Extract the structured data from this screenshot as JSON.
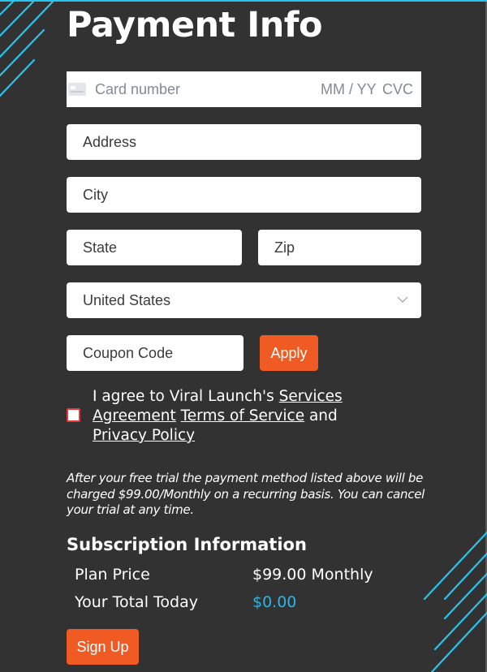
{
  "page": {
    "title": "Payment Info"
  },
  "card": {
    "icon": "credit-card-icon",
    "number_placeholder": "Card number",
    "expiry_placeholder": "MM / YY",
    "cvc_placeholder": "CVC"
  },
  "form": {
    "address_placeholder": "Address",
    "city_placeholder": "City",
    "state_placeholder": "State",
    "zip_placeholder": "Zip",
    "country_selected": "United States",
    "coupon_placeholder": "Coupon Code",
    "apply_label": "Apply"
  },
  "agreement": {
    "checked": false,
    "prefix": "I agree to Viral Launch's ",
    "services_link": "Services Agreement",
    "terms_link": "Terms of Service",
    "conjunction": " and ",
    "privacy_link": "Privacy Policy"
  },
  "trial_note": "After your free trial the payment method listed above will be charged $99.00/Monthly on a recurring basis. You can cancel your trial at any time.",
  "subscription": {
    "heading": "Subscription Information",
    "rows": [
      {
        "label": "Plan Price",
        "value": "$99.00 Monthly"
      },
      {
        "label": "Your Total Today",
        "value": "$0.00"
      }
    ]
  },
  "signup_label": "Sign Up",
  "colors": {
    "background": "#323232",
    "accent_blue": "#29c3ee",
    "button_orange": "#f05b24",
    "checkbox_border": "#e53939"
  }
}
